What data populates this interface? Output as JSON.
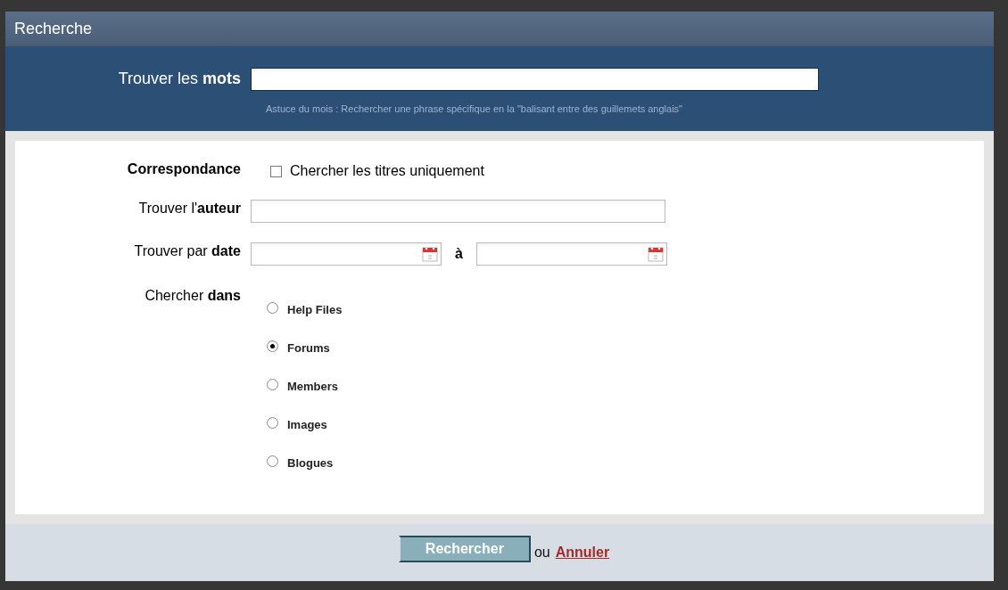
{
  "window": {
    "title": "Recherche"
  },
  "keywords": {
    "label": "Trouver les **mots**",
    "hint": "Astuce du mois : Rechercher une phrase spécifique en la \"balisant entre des guillemets anglais\""
  },
  "match": {
    "label": "Correspondance",
    "option": "Chercher les titres uniquement",
    "checked": false
  },
  "author": {
    "label": "Trouver l'**auteur**"
  },
  "date": {
    "label": "Trouver par **date**",
    "separator": "à"
  },
  "scope": {
    "label": "Chercher **dans**",
    "options": [
      {
        "label": "Help Files",
        "selected": false
      },
      {
        "label": "Forums",
        "selected": true
      },
      {
        "label": "Members",
        "selected": false
      },
      {
        "label": "Images",
        "selected": false
      },
      {
        "label": "Blogues",
        "selected": false
      }
    ]
  },
  "footer": {
    "submit": "Rechercher",
    "or": "ou",
    "cancel": "Annuler"
  }
}
